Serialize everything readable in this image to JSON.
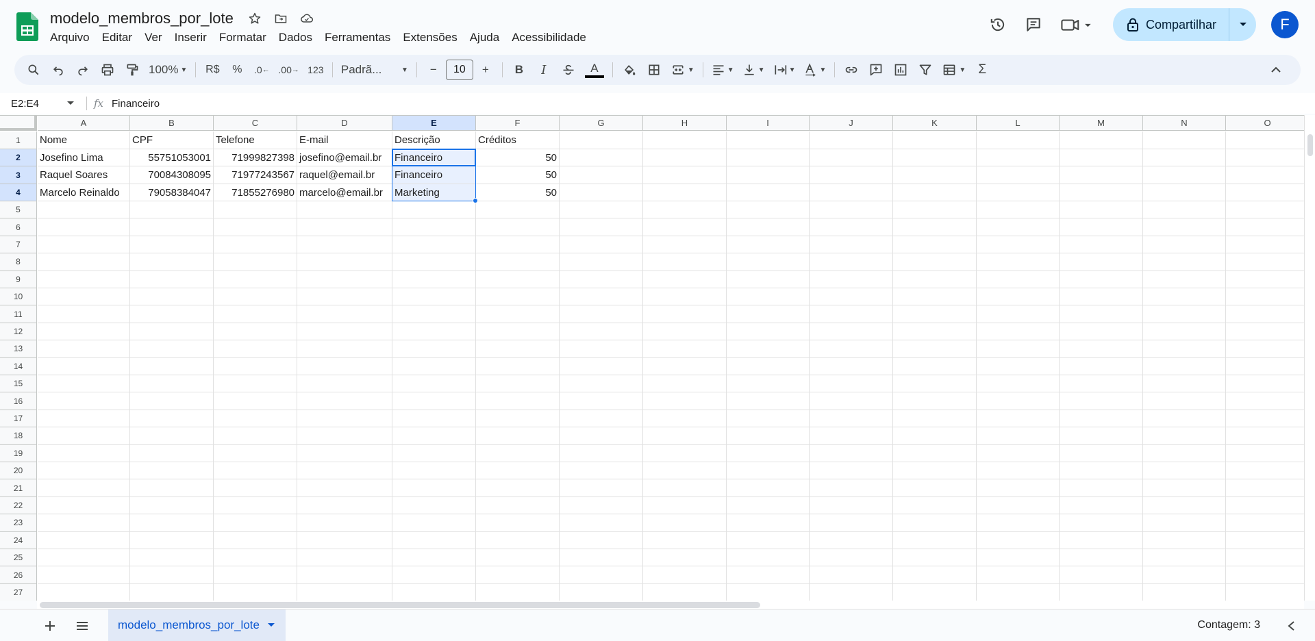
{
  "document": {
    "title": "modelo_membros_por_lote",
    "menu": [
      "Arquivo",
      "Editar",
      "Ver",
      "Inserir",
      "Formatar",
      "Dados",
      "Ferramentas",
      "Extensões",
      "Ajuda",
      "Acessibilidade"
    ],
    "share_label": "Compartilhar",
    "avatar_letter": "F"
  },
  "toolbar": {
    "zoom": "100%",
    "currency": "R$",
    "percent": "%",
    "dec_decrease": ".0",
    "dec_increase": ".00",
    "number_format": "123",
    "font": "Padrã...",
    "font_size": "10",
    "bold": "B",
    "italic": "I",
    "text_color_letter": "A",
    "functions": "Σ"
  },
  "formula_bar": {
    "name_box": "E2:E4",
    "fx": "fx",
    "formula": "Financeiro"
  },
  "grid": {
    "columns": [
      "A",
      "B",
      "C",
      "D",
      "E",
      "F",
      "G",
      "H",
      "I",
      "J",
      "K",
      "L",
      "M",
      "N",
      "O"
    ],
    "selected_column": "E",
    "rows": [
      "1",
      "2",
      "3",
      "4",
      "5",
      "6",
      "7",
      "8",
      "9",
      "10",
      "11",
      "12",
      "13",
      "14",
      "15",
      "16",
      "17",
      "18",
      "19",
      "20",
      "21",
      "22",
      "23",
      "24",
      "25",
      "26",
      "27"
    ],
    "selected_rows": [
      "2",
      "3",
      "4"
    ],
    "header_row": [
      "Nome",
      "CPF",
      "Telefone",
      "E-mail",
      "Descrição",
      "Créditos"
    ],
    "data_rows": [
      [
        "Josefino Lima",
        "55751053001",
        "71999827398",
        "josefino@email.br",
        "Financeiro",
        "50"
      ],
      [
        "Raquel Soares",
        "70084308095",
        "71977243567",
        "raquel@email.br",
        "Financeiro",
        "50"
      ],
      [
        "Marcelo Reinaldo",
        "79058384047",
        "71855276980",
        "marcelo@email.br",
        "Marketing",
        "50"
      ]
    ]
  },
  "bottom_bar": {
    "sheet_tab": "modelo_membros_por_lote",
    "count_label": "Contagem: 3"
  },
  "colors": {
    "accent": "#0b57d0",
    "selection_border": "#1a73e8",
    "selection_fill": "#e8f0fe",
    "header_selected": "#d3e3fd",
    "share_bg": "#c2e7ff",
    "sheets_green": "#0f9d58"
  },
  "icons": [
    "sheets-logo-icon",
    "star-icon",
    "move-folder-icon",
    "cloud-status-icon",
    "history-icon",
    "comments-icon",
    "meet-camera-icon",
    "lock-icon",
    "search-icon",
    "undo-icon",
    "redo-icon",
    "print-icon",
    "paint-format-icon",
    "fill-color-icon",
    "borders-icon",
    "merge-cells-icon",
    "align-left-icon",
    "valign-icon",
    "wrap-icon",
    "rotate-text-icon",
    "link-icon",
    "comment-add-icon",
    "chart-icon",
    "filter-icon",
    "table-view-icon",
    "collapse-toolbar-icon",
    "add-sheet-icon",
    "all-sheets-icon",
    "explore-icon"
  ]
}
